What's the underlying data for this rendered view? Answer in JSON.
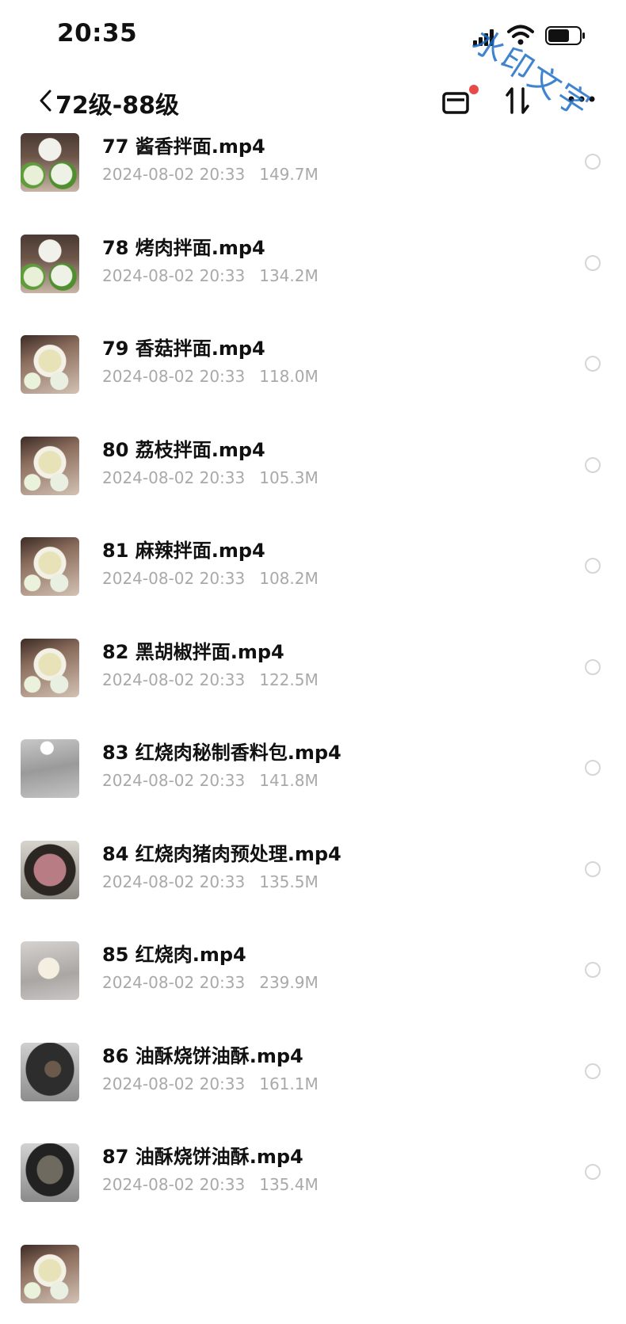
{
  "status_bar": {
    "time": "20:35"
  },
  "nav": {
    "title": "72级-88级",
    "icons": [
      "back-chevron-icon",
      "box-icon",
      "sort-icon",
      "more-icon"
    ],
    "notification_dot_color": "#e84a4a"
  },
  "watermark": {
    "text": "水印文字",
    "color": "#1e6ec8"
  },
  "files": [
    {
      "name": "77 酱香拌面.mp4",
      "date": "2024-08-02 20:33",
      "size": "149.7M",
      "thumb": "bowls"
    },
    {
      "name": "78 烤肉拌面.mp4",
      "date": "2024-08-02 20:33",
      "size": "134.2M",
      "thumb": "bowls"
    },
    {
      "name": "79 香菇拌面.mp4",
      "date": "2024-08-02 20:33",
      "size": "118.0M",
      "thumb": "hands"
    },
    {
      "name": "80 荔枝拌面.mp4",
      "date": "2024-08-02 20:33",
      "size": "105.3M",
      "thumb": "hands"
    },
    {
      "name": "81 麻辣拌面.mp4",
      "date": "2024-08-02 20:33",
      "size": "108.2M",
      "thumb": "hands"
    },
    {
      "name": "82 黑胡椒拌面.mp4",
      "date": "2024-08-02 20:33",
      "size": "122.5M",
      "thumb": "hands"
    },
    {
      "name": "83 红烧肉秘制香料包.mp4",
      "date": "2024-08-02 20:33",
      "size": "141.8M",
      "thumb": "steel"
    },
    {
      "name": "84 红烧肉猪肉预处理.mp4",
      "date": "2024-08-02 20:33",
      "size": "135.5M",
      "thumb": "wok-meat"
    },
    {
      "name": "85 红烧肉.mp4",
      "date": "2024-08-02 20:33",
      "size": "239.9M",
      "thumb": "dough"
    },
    {
      "name": "86 油酥烧饼油酥.mp4",
      "date": "2024-08-02 20:33",
      "size": "161.1M",
      "thumb": "wok"
    },
    {
      "name": "87 油酥烧饼油酥.mp4",
      "date": "2024-08-02 20:33",
      "size": "135.4M",
      "thumb": "wok2"
    },
    {
      "name": "",
      "date": "",
      "size": "",
      "thumb": "hands"
    }
  ]
}
